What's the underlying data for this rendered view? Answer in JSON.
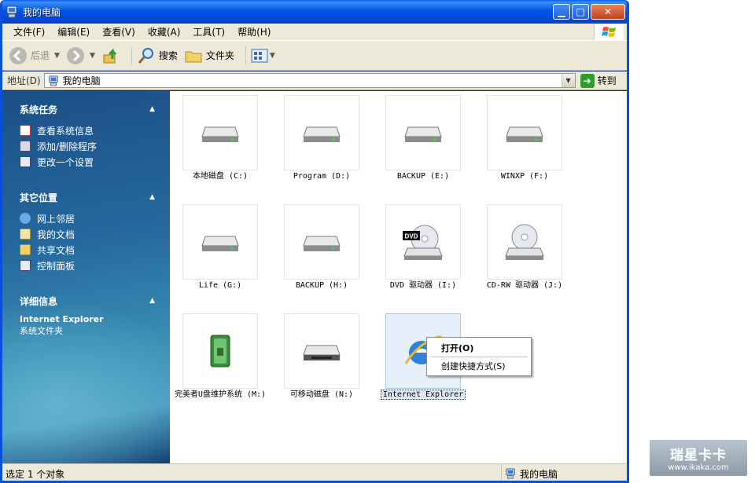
{
  "window": {
    "title": "我的电脑"
  },
  "caption_buttons": {
    "minimize": "▁",
    "maximize": "□",
    "close": "✕"
  },
  "menu": [
    "文件(F)",
    "编辑(E)",
    "查看(V)",
    "收藏(A)",
    "工具(T)",
    "帮助(H)"
  ],
  "toolbar": {
    "back": "后退",
    "search": "搜索",
    "folders": "文件夹"
  },
  "address": {
    "label": "地址(D)",
    "value": "我的电脑",
    "go": "转到"
  },
  "sidebar": {
    "system_tasks": {
      "title": "系统任务",
      "items": [
        "查看系统信息",
        "添加/删除程序",
        "更改一个设置"
      ]
    },
    "other_places": {
      "title": "其它位置",
      "items": [
        "网上邻居",
        "我的文档",
        "共享文档",
        "控制面板"
      ]
    },
    "details": {
      "title": "详细信息",
      "name": "Internet Explorer",
      "type": "系统文件夹"
    }
  },
  "items": [
    {
      "label": "本地磁盘 (C:)",
      "icon": "hard-drive-icon"
    },
    {
      "label": "Program (D:)",
      "icon": "hard-drive-icon"
    },
    {
      "label": "BACKUP (E:)",
      "icon": "hard-drive-icon"
    },
    {
      "label": "WINXP (F:)",
      "icon": "hard-drive-icon"
    },
    {
      "label": "Life (G:)",
      "icon": "hard-drive-icon"
    },
    {
      "label": "BACKUP (H:)",
      "icon": "hard-drive-icon"
    },
    {
      "label": "DVD 驱动器 (I:)",
      "icon": "dvd-drive-icon",
      "badge": "DVD"
    },
    {
      "label": "CD-RW 驱动器 (J:)",
      "icon": "cd-drive-icon"
    },
    {
      "label": "完美者U盘维护系统 (M:)",
      "icon": "usb-drive-icon"
    },
    {
      "label": "可移动磁盘 (N:)",
      "icon": "removable-disk-icon"
    },
    {
      "label": "Internet Explorer",
      "icon": "internet-explorer-icon",
      "selected": true
    }
  ],
  "context_menu": {
    "open": "打开(O)",
    "create_shortcut": "创建快捷方式(S)"
  },
  "status": {
    "left": "选定 1 个对象",
    "right": "我的电脑"
  },
  "watermark": {
    "big": "瑞星卡卡",
    "small": "www.ikaka.com"
  }
}
